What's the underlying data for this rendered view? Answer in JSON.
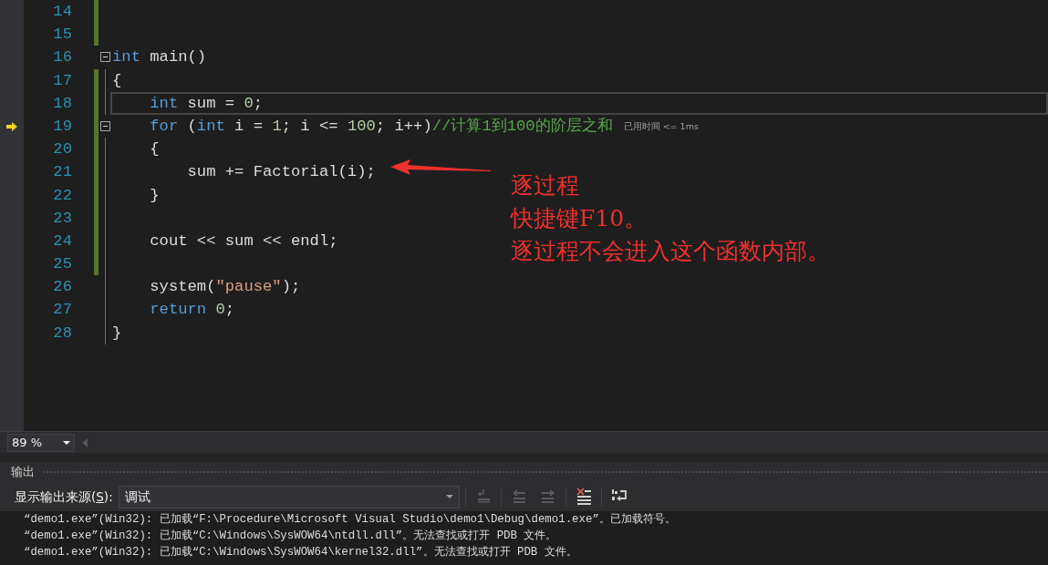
{
  "editor": {
    "lines": [
      {
        "number": "14",
        "changed": true,
        "foldable": false,
        "current": false,
        "execution_pointer": false
      },
      {
        "number": "15",
        "changed": true,
        "foldable": false,
        "current": false,
        "execution_pointer": false
      },
      {
        "number": "16",
        "changed": false,
        "foldable": true,
        "current": false,
        "execution_pointer": false,
        "tokens": [
          {
            "kind": "keyword",
            "text": "int"
          },
          {
            "kind": "plain",
            "text": " main()"
          }
        ]
      },
      {
        "number": "17",
        "changed": true,
        "foldable": false,
        "current": false,
        "execution_pointer": false,
        "tokens": [
          {
            "kind": "plain",
            "text": "{"
          }
        ]
      },
      {
        "number": "18",
        "changed": true,
        "foldable": false,
        "current": true,
        "execution_pointer": false,
        "tokens": [
          {
            "kind": "keyword",
            "text": "    int"
          },
          {
            "kind": "plain",
            "text": " sum = "
          },
          {
            "kind": "number",
            "text": "0"
          },
          {
            "kind": "plain",
            "text": ";"
          }
        ]
      },
      {
        "number": "19",
        "changed": true,
        "foldable": true,
        "current": false,
        "execution_pointer": true,
        "hint": "已用时间 <= 1ms",
        "tokens": [
          {
            "kind": "keyword",
            "text": "    for"
          },
          {
            "kind": "plain",
            "text": " ("
          },
          {
            "kind": "keyword",
            "text": "int"
          },
          {
            "kind": "plain",
            "text": " i = "
          },
          {
            "kind": "number",
            "text": "1"
          },
          {
            "kind": "plain",
            "text": "; i <= "
          },
          {
            "kind": "number",
            "text": "100"
          },
          {
            "kind": "plain",
            "text": "; i++)"
          },
          {
            "kind": "comment",
            "text": "//计算1到100的阶层之和"
          }
        ]
      },
      {
        "number": "20",
        "changed": true,
        "foldable": false,
        "current": false,
        "execution_pointer": false,
        "tokens": [
          {
            "kind": "plain",
            "text": "    {"
          }
        ]
      },
      {
        "number": "21",
        "changed": true,
        "foldable": false,
        "current": false,
        "execution_pointer": false,
        "tokens": [
          {
            "kind": "plain",
            "text": "        sum += Factorial(i);"
          }
        ]
      },
      {
        "number": "22",
        "changed": true,
        "foldable": false,
        "current": false,
        "execution_pointer": false,
        "tokens": [
          {
            "kind": "plain",
            "text": "    }"
          }
        ]
      },
      {
        "number": "23",
        "changed": true,
        "foldable": false,
        "current": false,
        "execution_pointer": false
      },
      {
        "number": "24",
        "changed": true,
        "foldable": false,
        "current": false,
        "execution_pointer": false,
        "tokens": [
          {
            "kind": "plain",
            "text": "    cout << sum << endl;"
          }
        ]
      },
      {
        "number": "25",
        "changed": true,
        "foldable": false,
        "current": false,
        "execution_pointer": false
      },
      {
        "number": "26",
        "changed": false,
        "foldable": false,
        "current": false,
        "execution_pointer": false,
        "tokens": [
          {
            "kind": "plain",
            "text": "    system("
          },
          {
            "kind": "string",
            "text": "\"pause\""
          },
          {
            "kind": "plain",
            "text": ");"
          }
        ]
      },
      {
        "number": "27",
        "changed": false,
        "foldable": false,
        "current": false,
        "execution_pointer": false,
        "tokens": [
          {
            "kind": "keyword",
            "text": "    return"
          },
          {
            "kind": "number",
            "text": " 0"
          },
          {
            "kind": "plain",
            "text": ";"
          }
        ]
      },
      {
        "number": "28",
        "changed": false,
        "foldable": false,
        "current": false,
        "execution_pointer": false,
        "tokens": [
          {
            "kind": "plain",
            "text": "}"
          }
        ]
      }
    ],
    "annotation": [
      "逐过程",
      "快捷键F10。",
      "逐过程不会进入这个函数内部。"
    ],
    "zoom": "89 %"
  },
  "output": {
    "title": "输出",
    "source_label": [
      "显示输出来源(",
      "S",
      "):"
    ],
    "source": "调试",
    "toolbar": [
      {
        "kind": "goto",
        "disabled": true
      },
      {
        "kind": "prev",
        "disabled": true
      },
      {
        "kind": "next",
        "disabled": true
      },
      {
        "kind": "clear",
        "disabled": false
      },
      {
        "kind": "wrap",
        "disabled": false
      }
    ],
    "lines": [
      "“demo1.exe”(Win32): 已加载“F:\\Procedure\\Microsoft Visual Studio\\demo1\\Debug\\demo1.exe”。已加载符号。",
      "“demo1.exe”(Win32): 已加载“C:\\Windows\\SysWOW64\\ntdll.dll”。无法查找或打开 PDB 文件。",
      "“demo1.exe”(Win32): 已加载“C:\\Windows\\SysWOW64\\kernel32.dll”。无法查找或打开 PDB 文件。"
    ]
  }
}
